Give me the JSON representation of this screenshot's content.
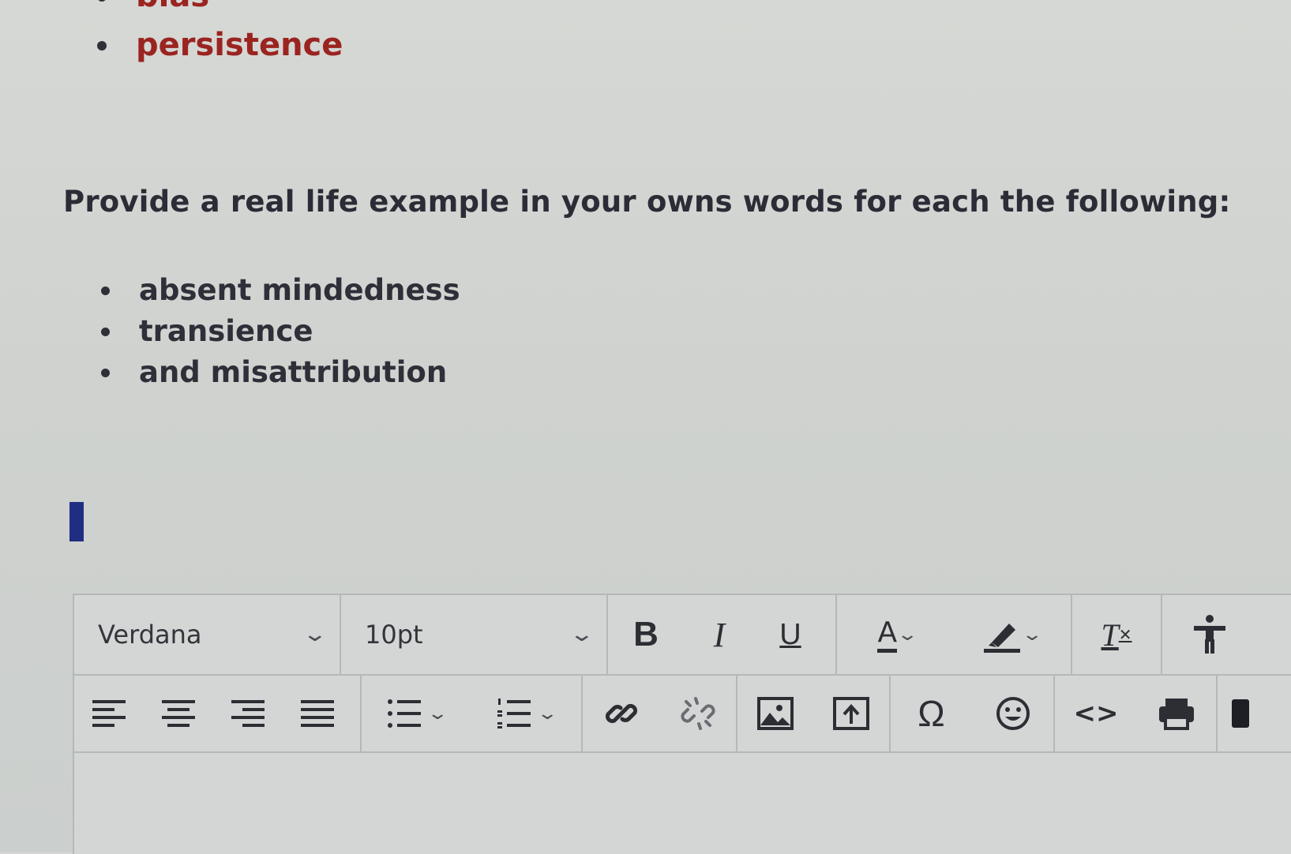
{
  "previous_list": [
    "bias",
    "persistence"
  ],
  "prompt": "Provide a real life  example in your owns words for each the following:",
  "items": [
    "absent mindedness",
    "transience",
    "and misattribution"
  ],
  "toolbar": {
    "font_family": "Verdana",
    "font_size": "10pt",
    "bold_label": "B",
    "italic_label": "I",
    "underline_label": "U",
    "text_color_label": "A",
    "clear_format_label": "T",
    "special_char_label": "Ω",
    "code_label": "<>"
  },
  "icons": {
    "font_dropdown": "chevron-down-icon",
    "size_dropdown": "chevron-down-icon",
    "highlight": "highlighter-icon",
    "accessibility": "accessibility-icon",
    "align_left": "align-left-icon",
    "align_center": "align-center-icon",
    "align_right": "align-right-icon",
    "align_justify": "align-justify-icon",
    "bullet_list": "bullet-list-icon",
    "numbered_list": "numbered-list-icon",
    "link": "link-icon",
    "unlink": "unlink-icon",
    "image": "image-icon",
    "upload": "upload-icon",
    "emoji": "emoji-icon",
    "print": "print-icon"
  },
  "colors": {
    "link_text": "#9a2420",
    "cursor": "#1f2d82"
  }
}
